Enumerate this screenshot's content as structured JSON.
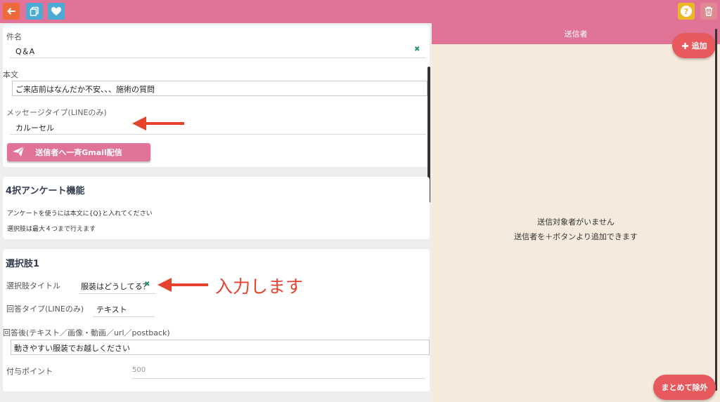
{
  "topbar": {
    "back_icon": "arrow-left-icon",
    "copy_icon": "copy-icon",
    "favorite_icon": "heart-icon",
    "help_icon": "question-icon",
    "help_glyph": "?",
    "trash_icon": "trash-icon",
    "bg_color": "#e07396"
  },
  "message": {
    "subject_label": "件名",
    "subject_value": "Q＆A",
    "body_label": "本文",
    "body_value": "ご来店前はなんだか不安、、、施術の質問",
    "type_label": "メッセージタイプ(LINEのみ)",
    "type_value": "カルーセル",
    "gmail_button": "送信者へ一斉Gmail配信"
  },
  "survey": {
    "title": "4択アンケート機能",
    "note1": "アンケートを使うには本文に{Q}と入れてください",
    "note2": "選択肢は最大４つまで行えます"
  },
  "choice1": {
    "title": "選択肢1",
    "choice_title_label": "選択肢タイトル",
    "choice_title_value": "服装はどうしてる？",
    "answer_type_label": "回答タイプ(LINEのみ)",
    "answer_type_value": "テキスト",
    "after_answer_label": "回答後(テキスト／画像・動画／url／postback)",
    "after_answer_value": "動きやすい服装でお越しください",
    "points_label": "付与ポイント",
    "points_placeholder": "500"
  },
  "annotation": {
    "input_text": "入力します",
    "color": "#e5432f"
  },
  "senders": {
    "header": "送信者",
    "add_button": "追加",
    "empty_line1": "送信対象者がいません",
    "empty_line2": "送信者を＋ボタンより追加できます",
    "bulk_remove_button": "まとめて除外",
    "panel_color": "#f5eadb",
    "button_color": "#e8595e"
  }
}
